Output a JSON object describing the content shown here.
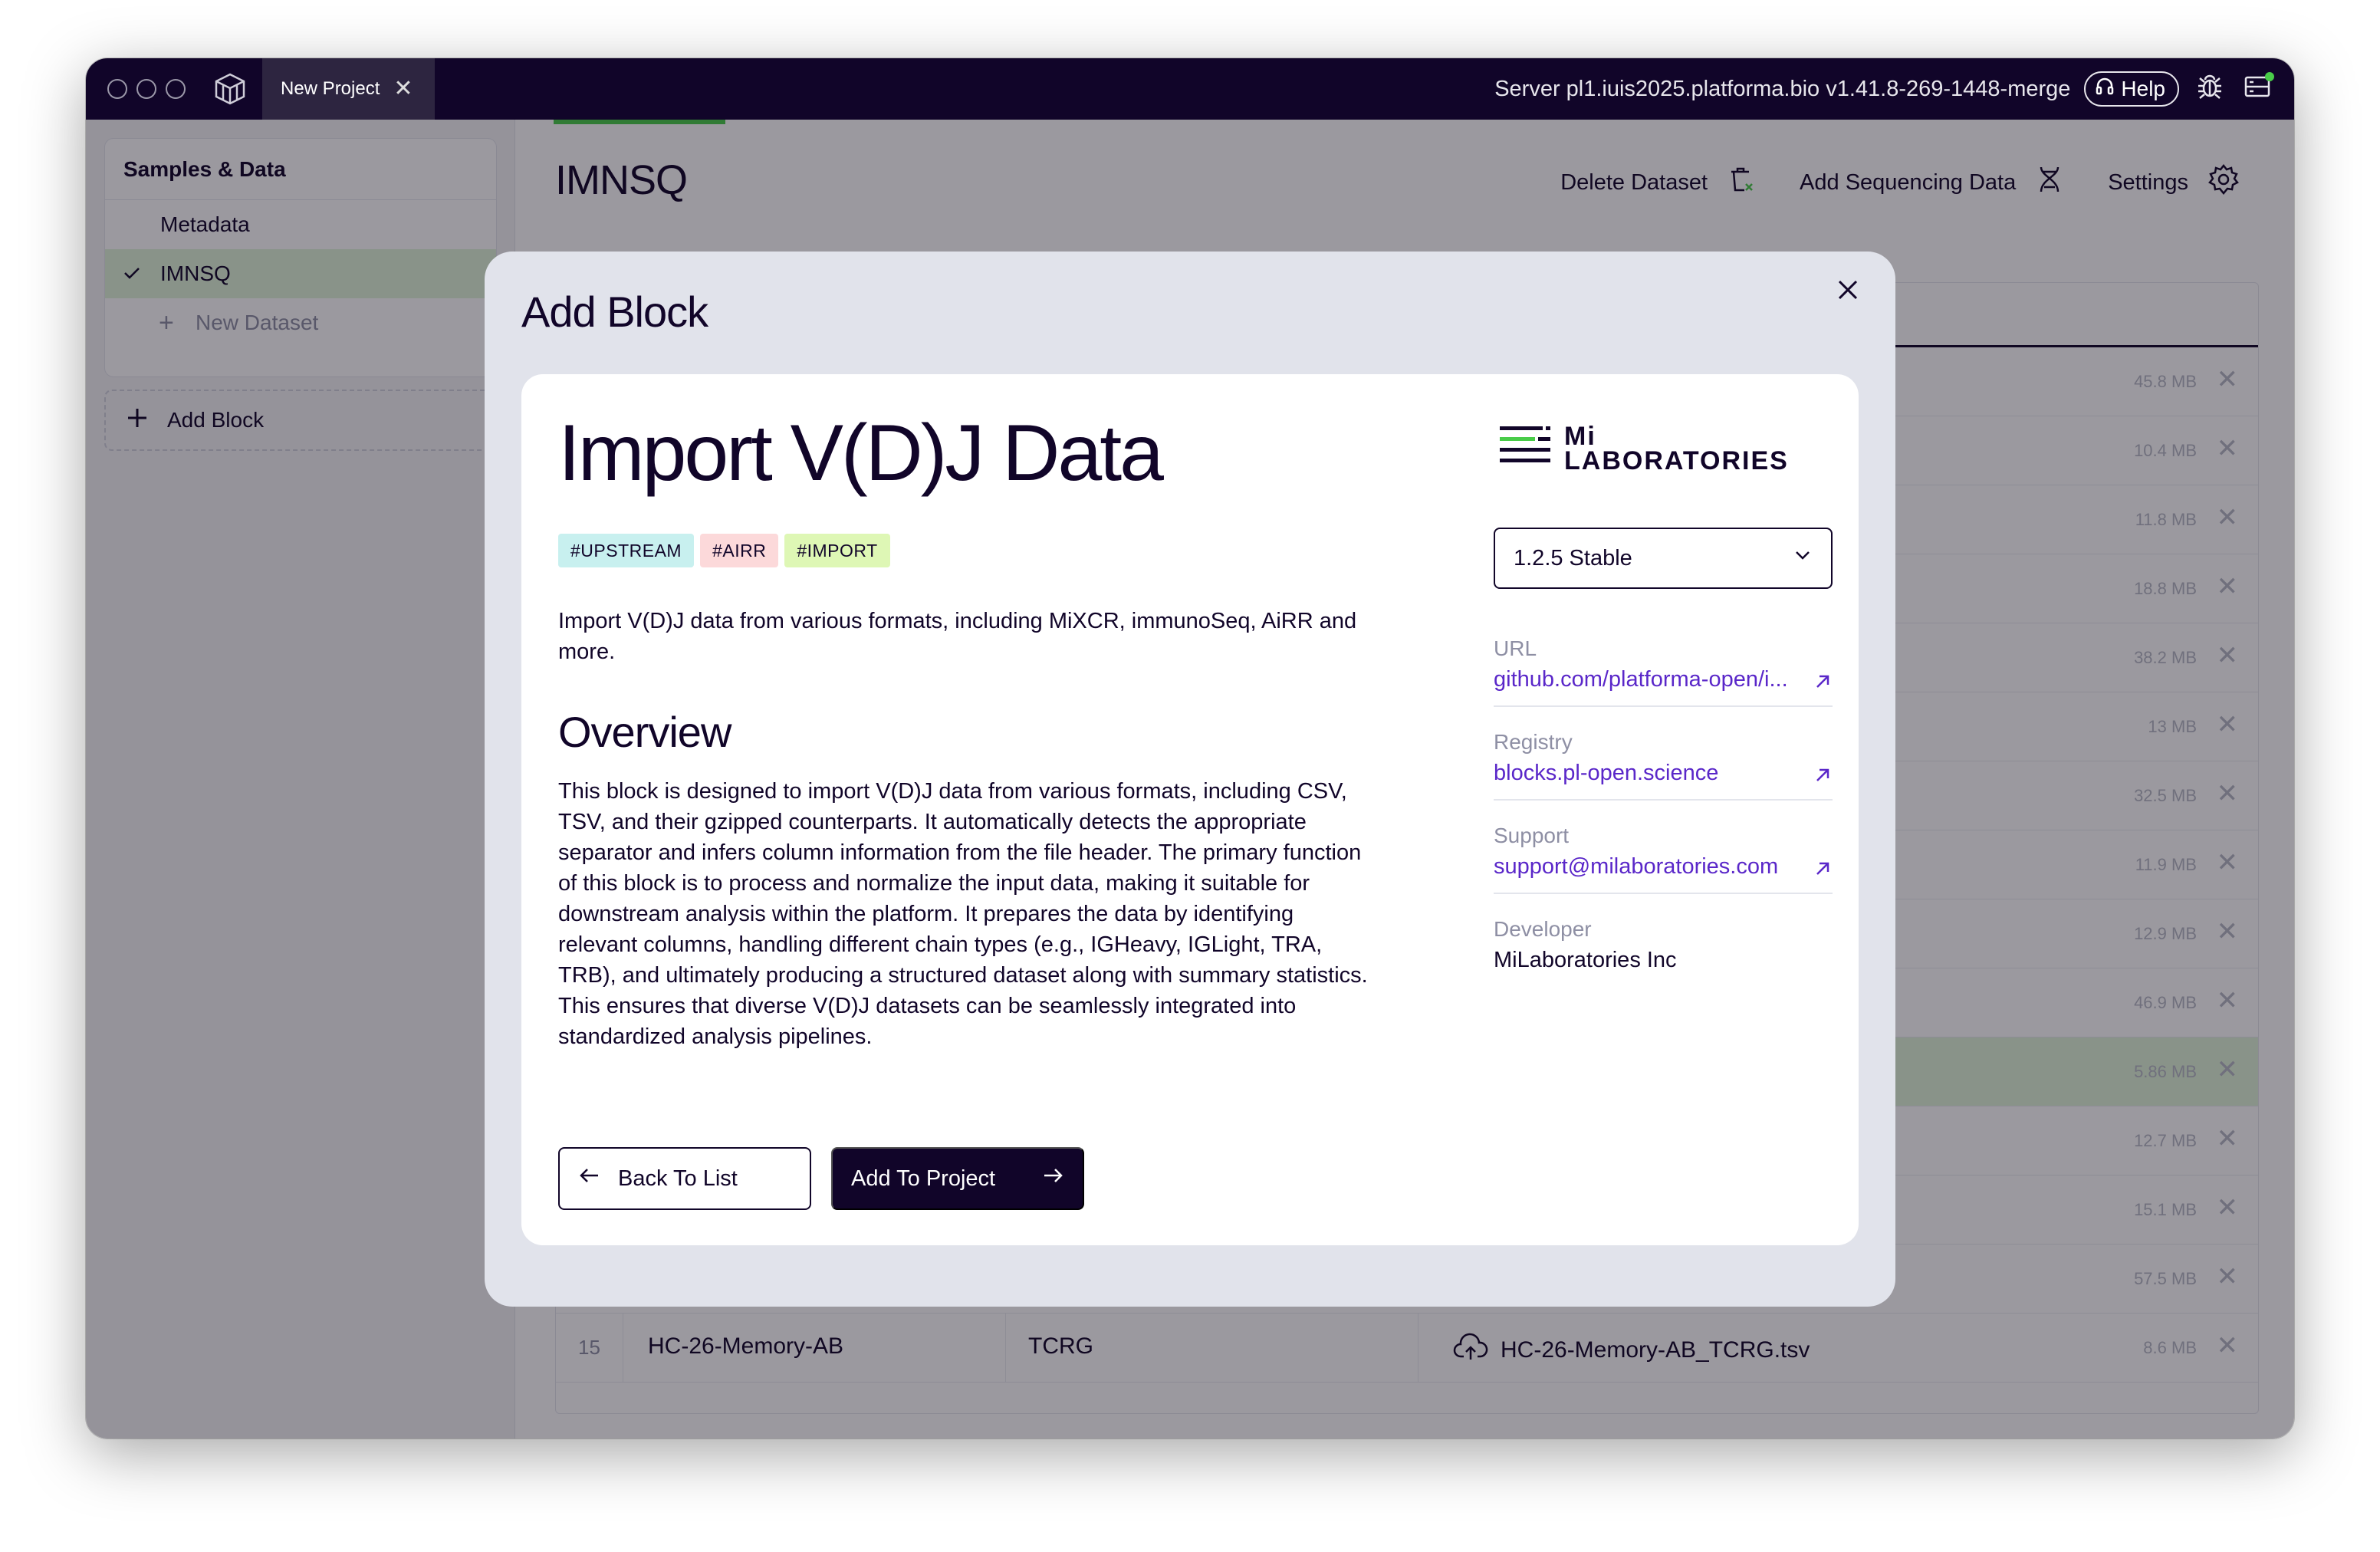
{
  "titlebar": {
    "tab_label": "New Project",
    "server_text": "Server pl1.iuis2025.platforma.bio v1.41.8-269-1448-merge",
    "help_label": "Help"
  },
  "sidebar": {
    "section_title": "Samples & Data",
    "items": [
      {
        "label": "Metadata"
      },
      {
        "label": "IMNSQ"
      },
      {
        "label": "New Dataset"
      }
    ],
    "add_block_label": "Add Block"
  },
  "main": {
    "title": "IMNSQ",
    "actions": {
      "delete_label": "Delete Dataset",
      "add_seq_label": "Add Sequencing Data",
      "settings_label": "Settings"
    },
    "sizes": [
      "45.8 MB",
      "10.4 MB",
      "11.8 MB",
      "18.8 MB",
      "38.2 MB",
      "13 MB",
      "32.5 MB",
      "11.9 MB",
      "12.9 MB",
      "46.9 MB",
      "5.86 MB",
      "12.7 MB",
      "15.1 MB",
      "57.5 MB"
    ],
    "last_row": {
      "num": "15",
      "sample": "HC-26-Memory-AB",
      "chain": "TCRG",
      "file": "HC-26-Memory-AB_TCRG.tsv",
      "size": "8.6 MB"
    }
  },
  "modal": {
    "title": "Add Block",
    "block_title": "Import V(D)J Data",
    "tags": [
      {
        "label": "#UPSTREAM",
        "color": "#c8f0ef"
      },
      {
        "label": "#AIRR",
        "color": "#fcd9da"
      },
      {
        "label": "#IMPORT",
        "color": "#def7b5"
      }
    ],
    "description": "Import V(D)J data from various formats, including MiXCR, immunoSeq, AiRR and more.",
    "overview_heading": "Overview",
    "overview_text": "This block is designed to import V(D)J data from various formats, including CSV, TSV, and their gzipped counterparts. It automatically detects the appropriate separator and infers column information from the file header. The primary function of this block is to process and normalize the input data, making it suitable for downstream analysis within the platform. It prepares the data by identifying relevant columns, handling different chain types (e.g., IGHeavy, IGLight, TRA, TRB), and ultimately producing a structured dataset along with summary statistics. This ensures that diverse V(D)J datasets can be seamlessly integrated into standardized analysis pipelines.",
    "back_label": "Back To List",
    "add_label": "Add To Project",
    "vendor_line1": "Mi",
    "vendor_line2": "LABORATORIES",
    "version": "1.2.5 Stable",
    "meta": {
      "url_label": "URL",
      "url_value": "github.com/platforma-open/i...",
      "registry_label": "Registry",
      "registry_value": "blocks.pl-open.science",
      "support_label": "Support",
      "support_value": "support@milaboratories.com",
      "developer_label": "Developer",
      "developer_value": "MiLaboratories Inc"
    }
  },
  "colors": {
    "brand_dark": "#110529",
    "accent_green": "#49cc49",
    "link_purple": "#5a27c9"
  }
}
